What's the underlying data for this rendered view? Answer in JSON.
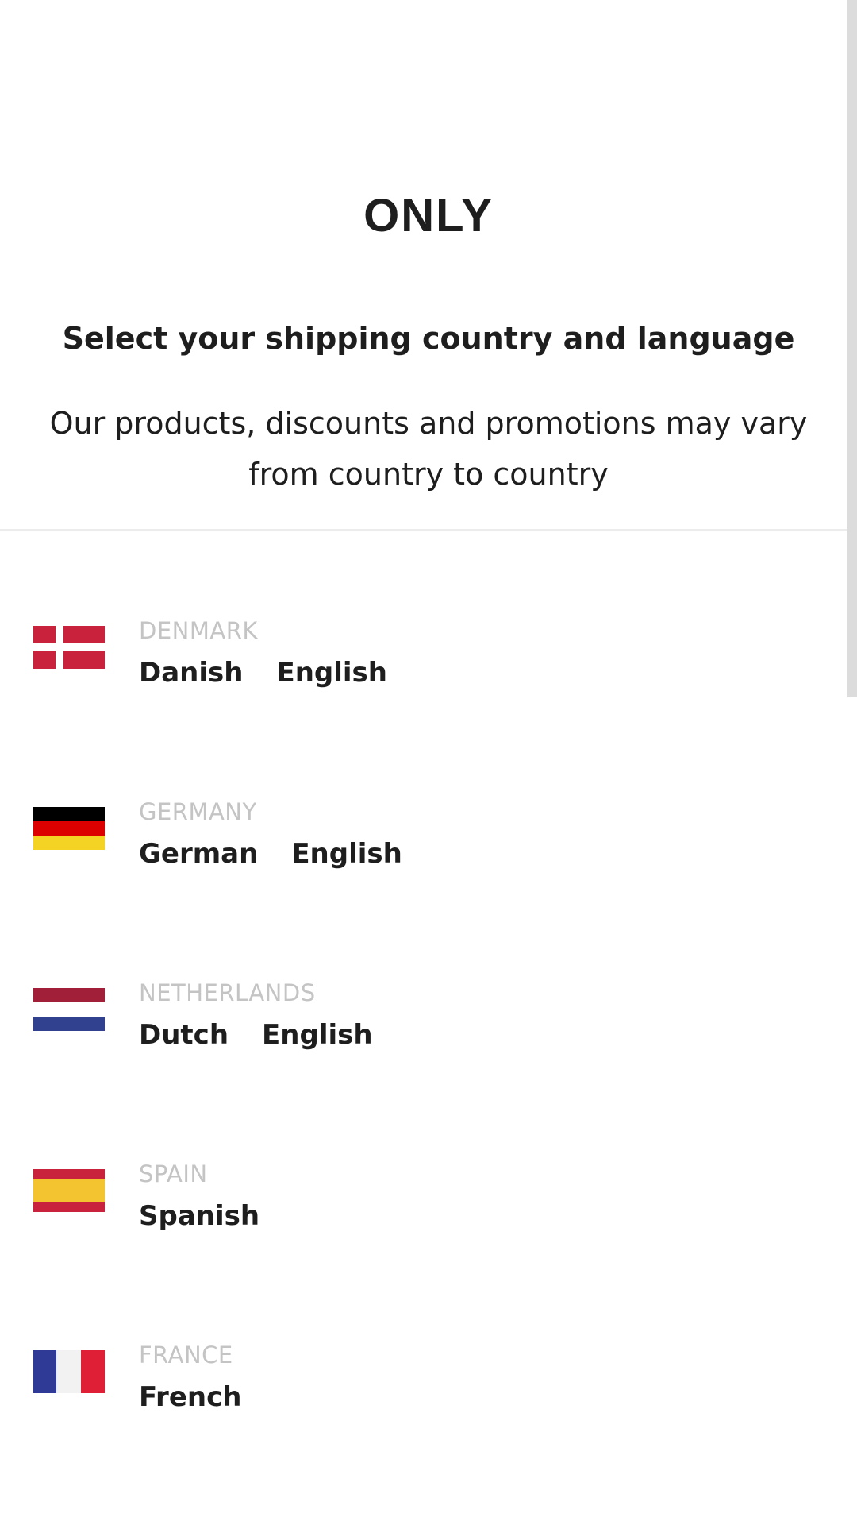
{
  "brand": {
    "logo_text": "ONLY"
  },
  "header": {
    "title": "Select your shipping country and language",
    "subtitle": "Our products, discounts and promotions may vary from country to country"
  },
  "countries": [
    {
      "name": "DENMARK",
      "flag": "denmark-flag",
      "languages": [
        "Danish",
        "English"
      ]
    },
    {
      "name": "GERMANY",
      "flag": "germany-flag",
      "languages": [
        "German",
        "English"
      ]
    },
    {
      "name": "NETHERLANDS",
      "flag": "netherlands-flag",
      "languages": [
        "Dutch",
        "English"
      ]
    },
    {
      "name": "SPAIN",
      "flag": "spain-flag",
      "languages": [
        "Spanish"
      ]
    },
    {
      "name": "FRANCE",
      "flag": "france-flag",
      "languages": [
        "French"
      ]
    }
  ],
  "colors": {
    "text": "#1e1e1e",
    "muted": "#c4c4c4",
    "divider": "#ececec",
    "scrollbar": "#dcdcdc",
    "flag_red": "#c8223c",
    "flag_black": "#000000",
    "flag_german_red": "#dd0000",
    "flag_gold": "#f4d325",
    "flag_dutch_red": "#a21f3a",
    "flag_dutch_blue": "#31418f",
    "flag_spain_yellow": "#f4c430",
    "flag_france_blue": "#2e3a96",
    "flag_france_red": "#de1f36"
  }
}
